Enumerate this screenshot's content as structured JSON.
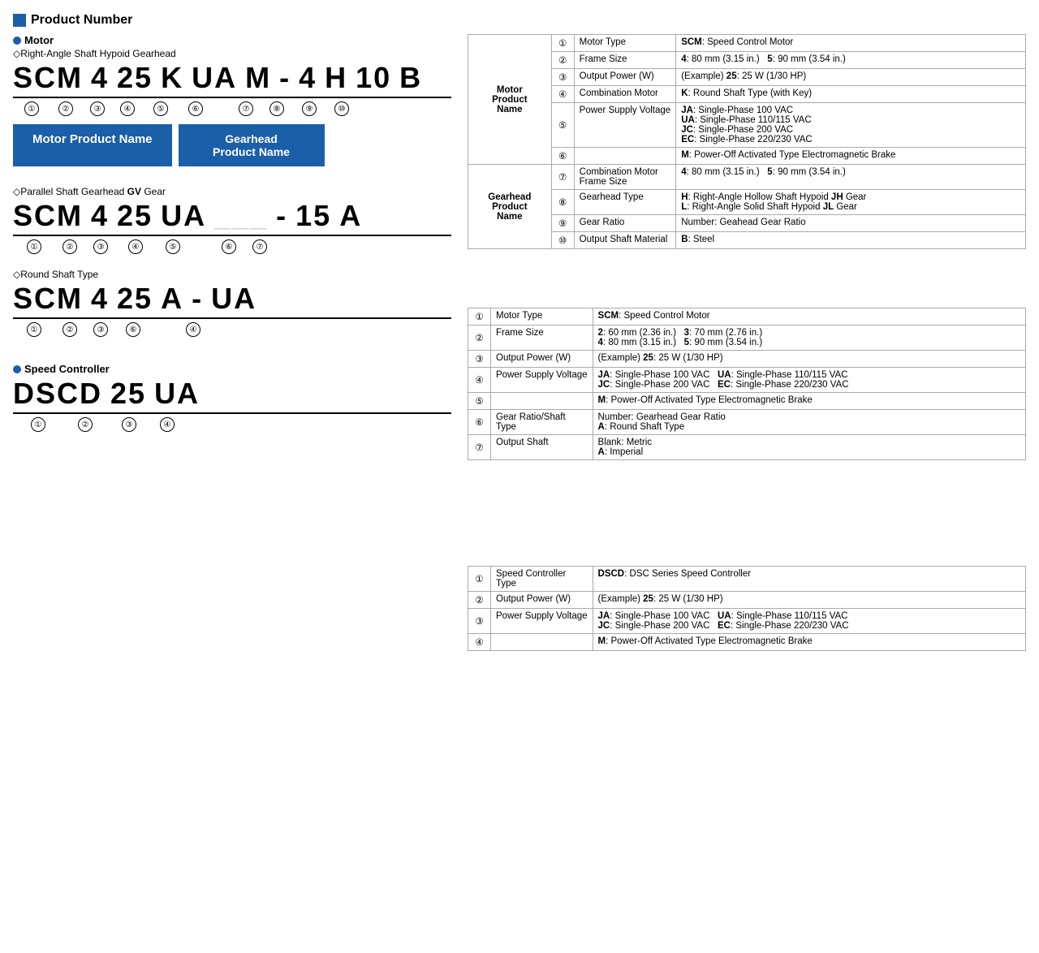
{
  "page": {
    "section_title": "Product Number",
    "motor_label": "Motor",
    "gearhead1_diamond": "Right-Angle Shaft Hypoid Gearhead",
    "gearhead2_diamond": "Parallel Shaft Gearhead GV Gear",
    "roundshaft_diamond": "Round Shaft Type",
    "sc_label": "Speed Controller",
    "product1": {
      "code": [
        "SCM",
        "4",
        "25",
        "K",
        "UA",
        "M",
        "-",
        "4",
        "H",
        "10",
        "B"
      ],
      "circles": [
        "①",
        "②",
        "③",
        "④",
        "⑤",
        "⑥",
        "",
        "⑦",
        "⑧",
        "⑨",
        "⑩"
      ],
      "motor_name_label": "Motor Product Name",
      "gearhead_name_label": "Gearhead\nProduct Name"
    },
    "product2": {
      "code": [
        "SCM",
        "4",
        "25",
        "UA",
        "",
        "-",
        "15",
        "A"
      ],
      "circles": [
        "①",
        "②",
        "③",
        "④",
        "⑤",
        "",
        "⑥",
        "⑦"
      ]
    },
    "product3": {
      "code": [
        "SCM",
        "4",
        "25",
        "A",
        "-",
        "UA"
      ],
      "circles": [
        "①",
        "②",
        "③",
        "⑥",
        "",
        "④"
      ]
    },
    "product4": {
      "code": [
        "DSCD",
        "25",
        "UA"
      ],
      "circles": [
        "①",
        "②",
        "③",
        "④"
      ]
    },
    "table1": {
      "group_rows": [
        {
          "group": "Motor\nProduct\nName",
          "rows": [
            {
              "num": "①",
              "key": "Motor Type",
              "val": "<b>SCM</b>: Speed Control Motor"
            },
            {
              "num": "②",
              "key": "Frame Size",
              "val": "<b>4</b>: 80 mm (3.15 in.)    <b>5</b>: 90 mm (3.54 in.)"
            },
            {
              "num": "③",
              "key": "Output Power (W)",
              "val": "(Example) <b>25</b>: 25 W (1/30 HP)"
            },
            {
              "num": "④",
              "key": "Combination Motor",
              "val": "<b>K</b>: Round Shaft Type (with Key)"
            },
            {
              "num": "⑤",
              "key": "Power Supply Voltage",
              "val": "<b>JA</b>: Single-Phase 100 VAC\n<b>UA</b>: Single-Phase 110/115 VAC\n<b>JC</b>: Single-Phase 200 VAC\n<b>EC</b>: Single-Phase 220/230 VAC"
            },
            {
              "num": "⑥",
              "key": "",
              "val": "<b>M</b>: Power-Off Activated Type Electromagnetic Brake"
            }
          ]
        },
        {
          "group": "Gearhead\nProduct\nName",
          "rows": [
            {
              "num": "⑦",
              "key": "Combination Motor\nFrame Size",
              "val": "<b>4</b>: 80 mm (3.15 in.)    <b>5</b>: 90 mm (3.54 in.)"
            },
            {
              "num": "⑧",
              "key": "Gearhead Type",
              "val": "<b>H</b>: Right-Angle Hollow Shaft Hypoid <b>JH</b> Gear\n<b>L</b>: Right-Angle Solid Shaft Hypoid <b>JL</b> Gear"
            },
            {
              "num": "⑨",
              "key": "Gear Ratio",
              "val": "Number: Geahead Gear Ratio"
            },
            {
              "num": "⑩",
              "key": "Output Shaft Material",
              "val": "<b>B</b>: Steel"
            }
          ]
        }
      ]
    },
    "table2": {
      "rows": [
        {
          "num": "①",
          "key": "Motor Type",
          "val": "<b>SCM</b>: Speed Control Motor"
        },
        {
          "num": "②",
          "key": "Frame Size",
          "val": "<b>2</b>: 60 mm (2.36 in.)    <b>3</b>: 70 mm (2.76 in.)\n<b>4</b>: 80 mm (3.15 in.)    <b>5</b>: 90 mm (3.54 in.)"
        },
        {
          "num": "③",
          "key": "Output Power (W)",
          "val": "(Example) <b>25</b>: 25 W (1/30 HP)"
        },
        {
          "num": "④",
          "key": "Power Supply Voltage",
          "val": "<b>JA</b>: Single-Phase 100 VAC    <b>UA</b>: Single-Phase 110/115 VAC\n<b>JC</b>: Single-Phase 200 VAC    <b>EC</b>: Single-Phase 220/230 VAC"
        },
        {
          "num": "⑤",
          "key": "",
          "val": "<b>M</b>: Power-Off Activated Type Electromagnetic Brake"
        },
        {
          "num": "⑥",
          "key": "Gear Ratio/Shaft\nType",
          "val": "Number: Gearhead Gear Ratio\n<b>A</b>: Round Shaft Type"
        },
        {
          "num": "⑦",
          "key": "Output Shaft",
          "val": "Blank: Metric\n<b>A</b>: Imperial"
        }
      ]
    },
    "table3": {
      "rows": [
        {
          "num": "①",
          "key": "Speed Controller\nType",
          "val": "<b>DSCD</b>: DSC Series Speed Controller"
        },
        {
          "num": "②",
          "key": "Output Power (W)",
          "val": "(Example) <b>25</b>: 25 W (1/30 HP)"
        },
        {
          "num": "③",
          "key": "Power Supply Voltage",
          "val": "<b>JA</b>: Single-Phase 100 VAC    <b>UA</b>: Single-Phase 110/115 VAC\n<b>JC</b>: Single-Phase 200 VAC    <b>EC</b>: Single-Phase 220/230 VAC"
        },
        {
          "num": "④",
          "key": "",
          "val": "<b>M</b>: Power-Off Activated Type Electromagnetic Brake"
        }
      ]
    }
  }
}
